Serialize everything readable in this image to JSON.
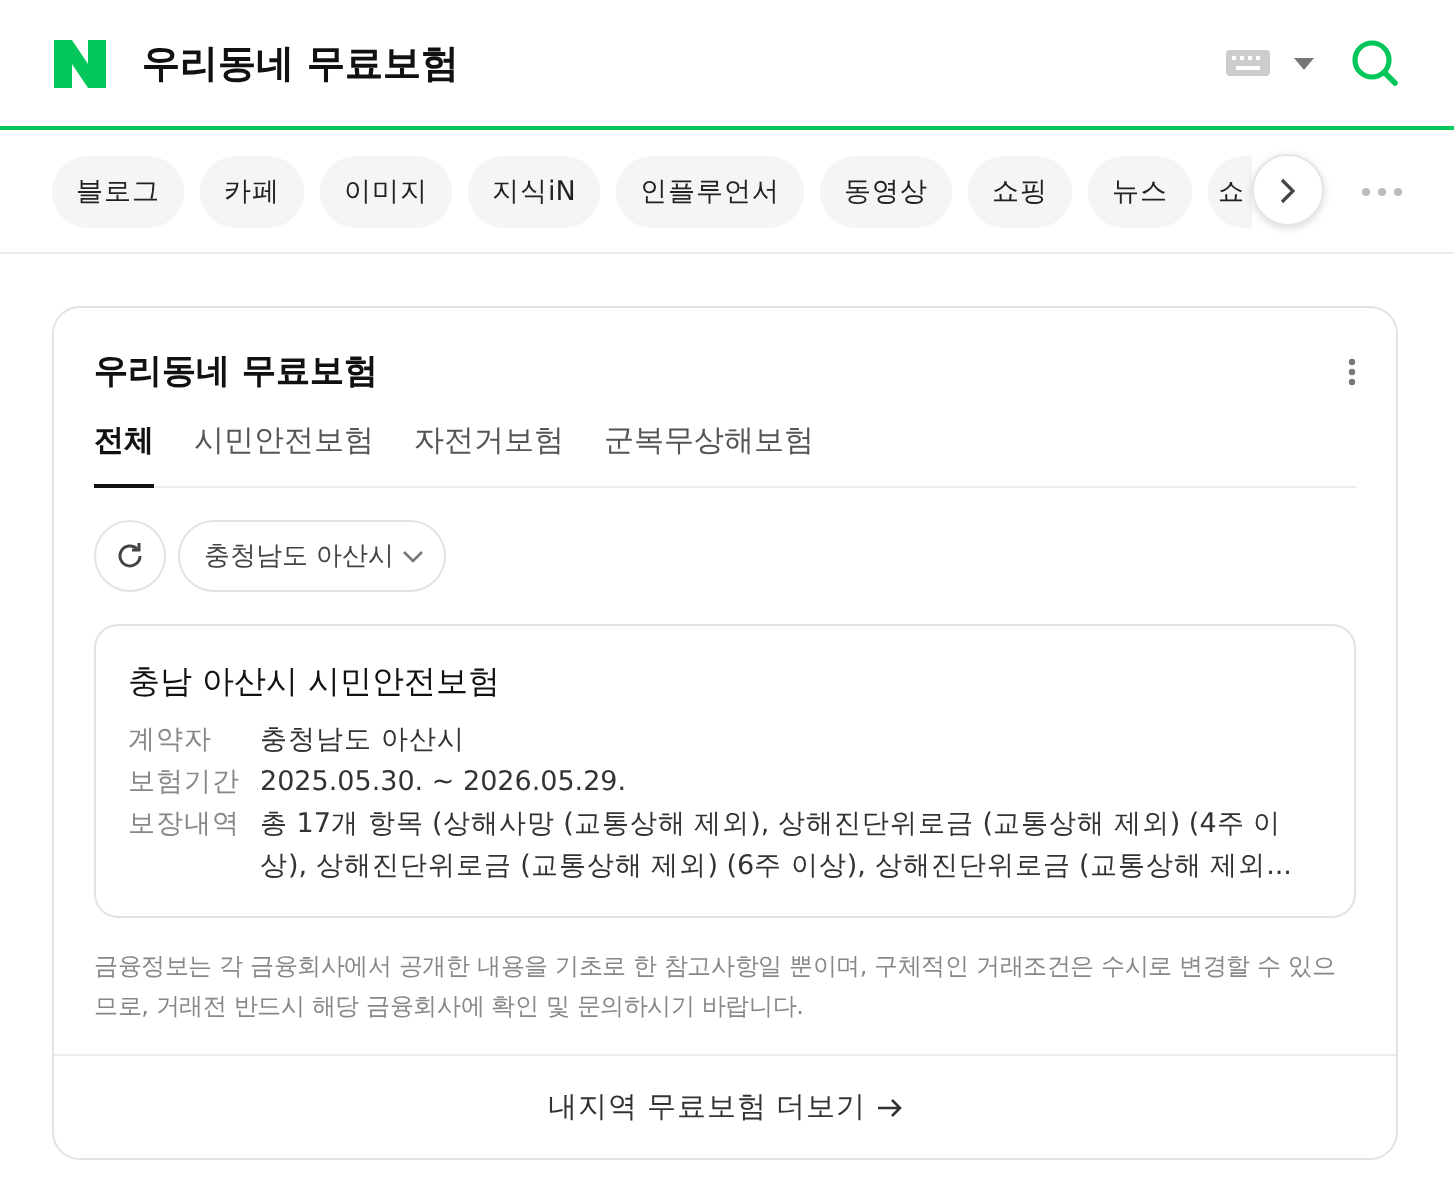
{
  "header": {
    "query": "우리동네 무료보험"
  },
  "chips": [
    {
      "label": "블로그"
    },
    {
      "label": "카페"
    },
    {
      "label": "이미지"
    },
    {
      "label": "지식iN"
    },
    {
      "label": "인플루언서"
    },
    {
      "label": "동영상"
    },
    {
      "label": "쇼핑"
    },
    {
      "label": "뉴스"
    },
    {
      "label": "쇼"
    }
  ],
  "card": {
    "title": "우리동네 무료보험",
    "tabs": [
      {
        "label": "전체",
        "selected": true
      },
      {
        "label": "시민안전보험",
        "selected": false
      },
      {
        "label": "자전거보험",
        "selected": false
      },
      {
        "label": "군복무상해보험",
        "selected": false
      }
    ],
    "region_select": "충청남도 아산시",
    "policy": {
      "title": "충남 아산시 시민안전보험",
      "rows": [
        {
          "label": "계약자",
          "value": "충청남도 아산시"
        },
        {
          "label": "보험기간",
          "value": "2025.05.30. ~ 2026.05.29."
        },
        {
          "label": "보장내역",
          "value": "총 17개 항목 (상해사망 (교통상해 제외), 상해진단위로금 (교통상해 제외) (4주 이상), 상해진단위로금 (교통상해 제외) (6주 이상), 상해진단위로금 (교통상해 제외..."
        }
      ]
    },
    "notice": "금융정보는 각 금융회사에서 공개한 내용을 기초로 한 참고사항일 뿐이며, 구체적인 거래조건은 수시로 변경할 수 있으므로, 거래전 반드시 해당 금융회사에 확인 및 문의하시기 바랍니다.",
    "more_link": "내지역 무료보험 더보기"
  }
}
